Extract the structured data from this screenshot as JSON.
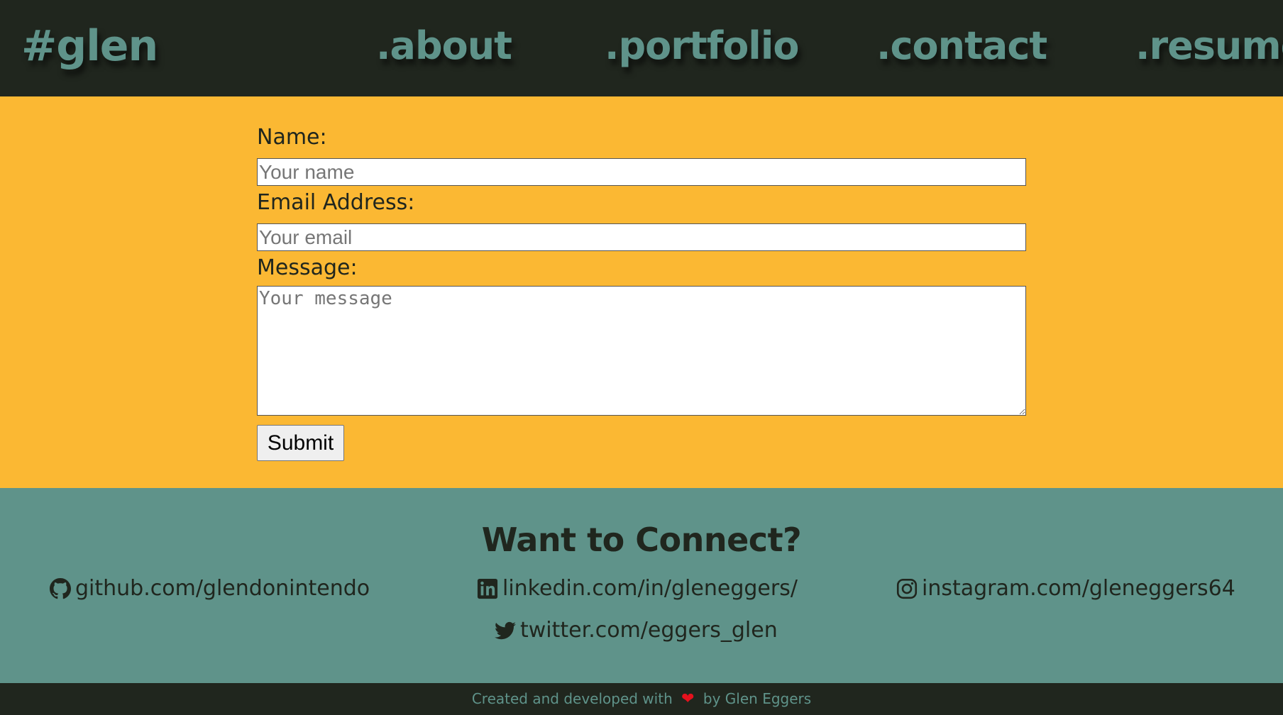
{
  "header": {
    "logo": "#glen",
    "nav": {
      "about": ".about",
      "portfolio": ".portfolio",
      "contact": ".contact",
      "resume": ".resume"
    }
  },
  "form": {
    "name_label": "Name:",
    "name_placeholder": "Your name",
    "name_value": "",
    "email_label": "Email Address:",
    "email_placeholder": "Your email",
    "email_value": "",
    "message_label": "Message:",
    "message_placeholder": "Your message",
    "message_value": "",
    "submit_label": "Submit"
  },
  "connect": {
    "title": "Want to Connect?",
    "links": {
      "github": {
        "icon": "github-icon",
        "label": "github.com/glendonintendo"
      },
      "linkedin": {
        "icon": "linkedin-icon",
        "label": "linkedin.com/in/gleneggers/"
      },
      "instagram": {
        "icon": "instagram-icon",
        "label": "instagram.com/gleneggers64"
      },
      "twitter": {
        "icon": "twitter-icon",
        "label": "twitter.com/eggers_glen"
      }
    }
  },
  "footer": {
    "prefix": "Created and developed with",
    "heart_icon": "heart-icon",
    "suffix": "by Glen Eggers"
  },
  "colors": {
    "dark": "#20261e",
    "teal": "#5f938a",
    "amber": "#fbb833",
    "heart": "#e5111d"
  }
}
